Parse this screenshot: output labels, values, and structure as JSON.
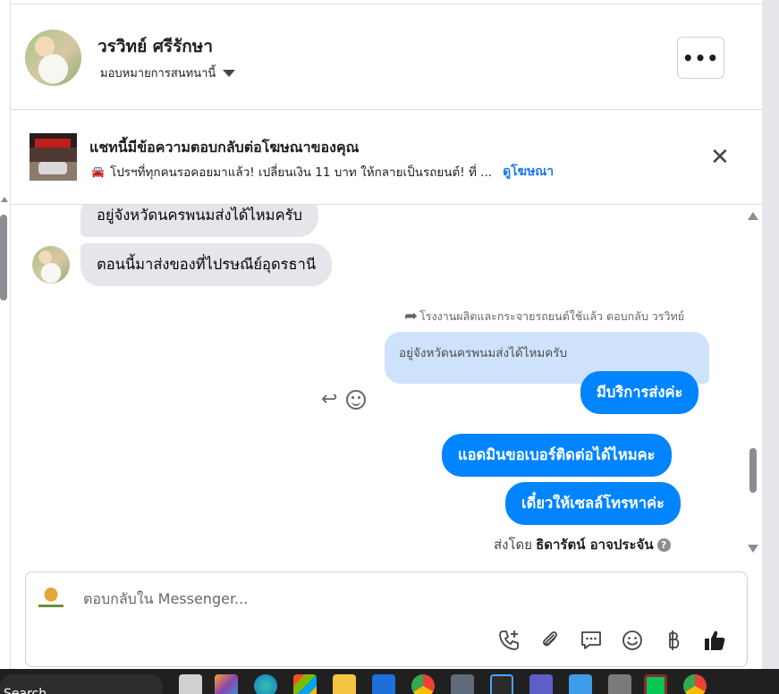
{
  "header": {
    "contact_name": "วรวิทย์ ศรีรักษา",
    "assign_label": "มอบหมายการสนทนานี้",
    "more_label": "•••"
  },
  "ad_banner": {
    "title": "แชทนี้มีข้อความตอบกลับต่อโฆษณาของคุณ",
    "subtitle": "โปรฯที่ทุกคนรอคอยมาแล้ว! เปลี่ยนเงิน 11 บาท ให้กลายเป็นรถยนต์! ที่ ...",
    "link": "ดูโฆษณา"
  },
  "messages": {
    "incoming": [
      "อยู่จังหวัดนครพนมส่งได้ไหมครับ",
      "ตอนนี้มาส่งของที่ไปรษณีย์อุดรธานี"
    ],
    "reply_note": "โรงงานผลิตและกระจายรถยนต์ใช้แล้ว ตอบกลับ วรวิทย์",
    "quoted_text": "อยู่จังหวัดนครพนมส่งได้ไหมครับ",
    "outgoing": [
      "มีบริการส่งค่ะ",
      "แอดมินขอเบอร์ติดต่อได้ไหมคะ",
      "เดี๋ยวให้เซลล์โทรหาค่ะ"
    ],
    "sent_by_prefix": "ส่งโดย",
    "sent_by_name": "ธิดารัตน์ อาจประจัน"
  },
  "composer": {
    "placeholder": "ตอบกลับใน Messenger...",
    "tools": [
      "call-add-icon",
      "paperclip-icon",
      "saved-reply-icon",
      "emoji-icon",
      "baht-icon",
      "like-icon"
    ]
  },
  "taskbar": {
    "search_label": "Search"
  },
  "colors": {
    "outgoing_bubble": "#0084ff",
    "incoming_bubble": "#e4e6eb",
    "quoted_bubble": "#cfe2fb",
    "link": "#1877f2"
  }
}
